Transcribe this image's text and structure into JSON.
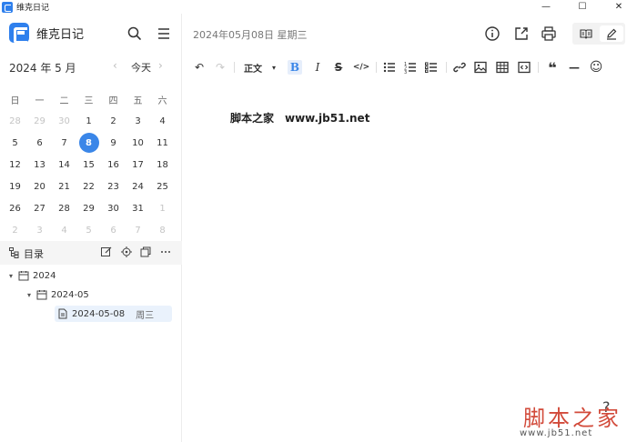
{
  "window": {
    "title": "维克日记",
    "minimize": "—",
    "maximize": "☐",
    "close": "✕"
  },
  "sidebar": {
    "app_name": "维克日记",
    "calendar": {
      "header": "2024 年 5 月",
      "prev": "‹",
      "today": "今天",
      "next": "›",
      "weekdays": [
        "日",
        "一",
        "二",
        "三",
        "四",
        "五",
        "六"
      ],
      "days": [
        [
          "28",
          "29",
          "30",
          "1",
          "2",
          "3",
          "4"
        ],
        [
          "5",
          "6",
          "7",
          "8",
          "9",
          "10",
          "11"
        ],
        [
          "12",
          "13",
          "14",
          "15",
          "16",
          "17",
          "18"
        ],
        [
          "19",
          "20",
          "21",
          "22",
          "23",
          "24",
          "25"
        ],
        [
          "26",
          "27",
          "28",
          "29",
          "30",
          "31",
          "1"
        ],
        [
          "2",
          "3",
          "4",
          "5",
          "6",
          "7",
          "8"
        ]
      ],
      "selected": "8"
    },
    "toc": {
      "label": "目录"
    },
    "tree": {
      "year": "2024",
      "month": "2024-05",
      "entry": "2024-05-08",
      "entry_weekday": "周三"
    }
  },
  "main": {
    "date_title": "2024年05月08日 星期三",
    "toolbar": {
      "undo": "↶",
      "redo": "↷",
      "style": "正文",
      "style_caret": "▾",
      "bold": "B",
      "italic": "I",
      "strike": "S",
      "code": "</>",
      "quote": "❝",
      "hr": "—",
      "emoji": "☺"
    },
    "content": "脚本之家　www.jb51.net"
  },
  "watermark": {
    "text": "脚本之家",
    "url": "www.jb51.net"
  },
  "help": "?"
}
